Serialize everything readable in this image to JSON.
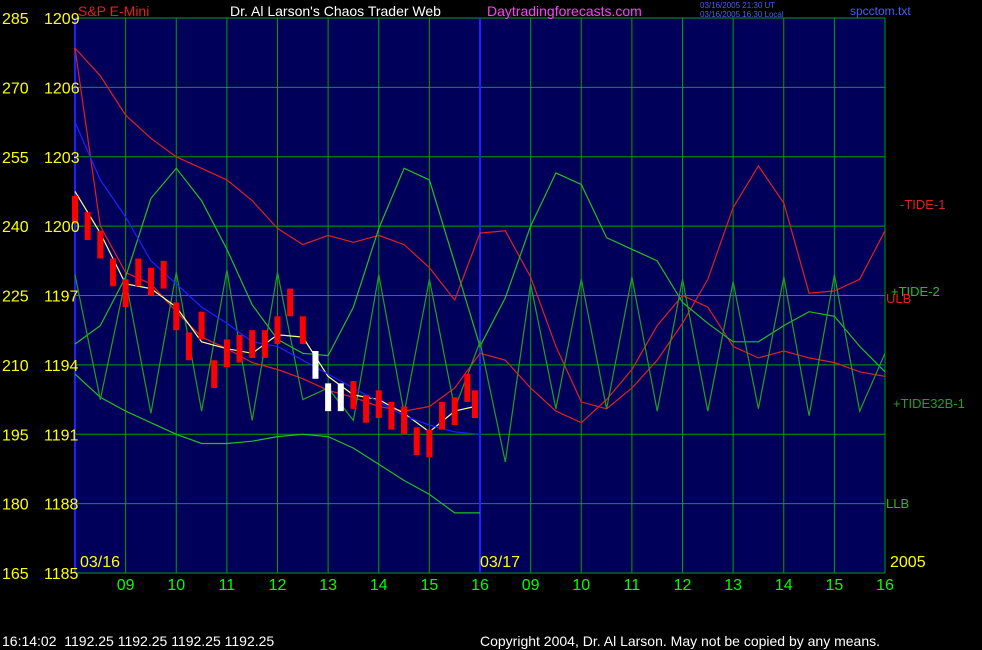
{
  "header": {
    "instrument": "S&P E-Mini",
    "title": "Dr. Al Larson's Chaos Trader Web",
    "site": "Daytradingforecasts.com",
    "timestamp_ut": "03/16/2005 21:30 UT",
    "timestamp_local": "03/16/2005 16:30 Local",
    "filename": "spcctom.txt"
  },
  "footer": {
    "readout": "16:14:02  1192.25 1192.25 1192.25 1192.25",
    "copyright": "Copyright 2004, Dr. Al Larson. May not be copied by any means."
  },
  "colors": {
    "background": "#000000",
    "plot_bg": "#00005a",
    "grid": "#00a000",
    "price_bars": "#ff0000",
    "price_bars_highlight": "#ffffff",
    "moving_avg": "#ffff80",
    "blue_curve": "#2020ff",
    "axis_text": "#ffff00",
    "hour_labels": "#00ff00",
    "tide1": "#e02020",
    "tide2": "#20c020",
    "tide32b1": "#20a020",
    "title_text": "#ffffff",
    "site_text": "#ff40ff"
  },
  "chart_data": {
    "type": "line",
    "y_axis_left_outer": [
      "285",
      "270",
      "255",
      "240",
      "225",
      "210",
      "195",
      "180",
      "165"
    ],
    "y_axis_left_inner": [
      "1209",
      "1206",
      "1203",
      "1200",
      "1197",
      "1194",
      "1191",
      "1188",
      "1185"
    ],
    "ylim": [
      1185,
      1209
    ],
    "x_hours_day1": [
      "09",
      "10",
      "11",
      "12",
      "13",
      "14",
      "15",
      "16"
    ],
    "x_hours_day2": [
      "09",
      "10",
      "11",
      "12",
      "13",
      "14",
      "15",
      "16"
    ],
    "date_labels": [
      "03/16",
      "03/17",
      "2005"
    ],
    "curve_labels": [
      "-TIDE-1",
      "+TIDE-2",
      "ULB",
      "+TIDE32B-1",
      "LLB"
    ],
    "series": [
      {
        "name": "-TIDE-1",
        "x": [
          0,
          0.5,
          1,
          1.5,
          2,
          2.5,
          3,
          3.5,
          4,
          4.5,
          5,
          5.5,
          6,
          6.5,
          7,
          7.5,
          8,
          8.5,
          9,
          9.5,
          10,
          10.5,
          11,
          11.5,
          12,
          12.5,
          13,
          13.5,
          14,
          14.5,
          15,
          15.5,
          16
        ],
        "values": [
          1207.7,
          1206.5,
          1204.8,
          1203.8,
          1203.0,
          1202.5,
          1202.0,
          1201.1,
          1199.9,
          1199.2,
          1199.6,
          1199.3,
          1199.6,
          1199.2,
          1198.2,
          1196.8,
          1199.7,
          1199.8,
          1197.8,
          1194.8,
          1192.4,
          1192.1,
          1193.0,
          1194.2,
          1195.8,
          1197.7,
          1200.8,
          1202.6,
          1201.0,
          1197.1,
          1197.2,
          1197.7,
          1199.8
        ]
      },
      {
        "name": "ULB",
        "x": [
          0,
          0.5,
          1,
          1.5,
          2,
          2.5,
          3,
          3.5,
          4,
          4.5,
          5,
          5.5,
          6,
          6.5,
          7,
          7.5,
          8,
          8.5,
          9,
          9.5,
          10,
          10.5,
          11,
          11.5,
          12,
          12.5,
          13,
          13.5,
          14,
          14.5,
          15,
          15.5,
          16
        ],
        "values": [
          1207.7,
          1200.0,
          1198.0,
          1197.5,
          1196.3,
          1195.2,
          1194.7,
          1194.1,
          1193.8,
          1193.4,
          1192.9,
          1192.6,
          1192.2,
          1192.0,
          1192.2,
          1193.0,
          1194.5,
          1194.2,
          1193.0,
          1192.0,
          1191.5,
          1192.5,
          1193.8,
          1195.7,
          1197.0,
          1196.5,
          1194.8,
          1194.3,
          1194.6,
          1194.3,
          1194.1,
          1193.7,
          1193.5
        ]
      },
      {
        "name": "+TIDE-2",
        "x": [
          0,
          0.5,
          1,
          1.5,
          2,
          2.5,
          3,
          3.5,
          4,
          4.5,
          5,
          5.5,
          6,
          6.5,
          7,
          7.5,
          8,
          8.5,
          9,
          9.5,
          10,
          10.5,
          11,
          11.5,
          12,
          12.5,
          13,
          13.5,
          14,
          14.5,
          15,
          15.5,
          16
        ],
        "values": [
          1194.9,
          1195.7,
          1197.8,
          1201.2,
          1202.5,
          1201.1,
          1199.0,
          1196.6,
          1195.1,
          1194.5,
          1194.4,
          1196.5,
          1199.9,
          1202.5,
          1202.0,
          1198.4,
          1194.8,
          1196.9,
          1200.0,
          1202.3,
          1201.8,
          1199.5,
          1199.0,
          1198.5,
          1196.7,
          1195.8,
          1195.0,
          1195.0,
          1195.7,
          1196.3,
          1196.1,
          1194.8,
          1193.7
        ]
      },
      {
        "name": "LLB",
        "x": [
          0,
          0.5,
          1,
          1.5,
          2,
          2.5,
          3,
          3.5,
          4,
          4.5,
          5,
          5.5,
          6,
          6.5,
          7,
          7.5,
          8
        ],
        "values": [
          1193.6,
          1192.6,
          1192.0,
          1191.5,
          1191.0,
          1190.6,
          1190.6,
          1190.7,
          1190.9,
          1191.0,
          1190.9,
          1190.4,
          1189.7,
          1189.0,
          1188.4,
          1187.6,
          1187.6
        ]
      },
      {
        "name": "+TIDE32B-1",
        "x": [
          0,
          0.5,
          1,
          1.5,
          2,
          2.5,
          3,
          3.5,
          4,
          4.5,
          5,
          5.5,
          6,
          6.5,
          7,
          7.5,
          8,
          8.5,
          9,
          9.5,
          10,
          10.5,
          11,
          11.5,
          12,
          12.5,
          13,
          13.5,
          14,
          14.5,
          15,
          15.5,
          16
        ],
        "values": [
          1197.9,
          1192.5,
          1197.7,
          1191.9,
          1198.0,
          1192.0,
          1198.1,
          1191.6,
          1198.0,
          1192.5,
          1193.0,
          1191.6,
          1197.9,
          1191.9,
          1197.7,
          1192.1,
          1195.0,
          1189.8,
          1197.5,
          1192.1,
          1197.7,
          1192.1,
          1197.8,
          1192.0,
          1197.7,
          1192.0,
          1197.6,
          1192.1,
          1197.8,
          1191.8,
          1197.9,
          1192.0,
          1194.5
        ]
      },
      {
        "name": "price",
        "x": [
          0,
          0.25,
          0.5,
          0.75,
          1,
          1.25,
          1.5,
          1.75,
          2,
          2.25,
          2.5,
          2.75,
          3,
          3.25,
          3.5,
          3.75,
          4,
          4.25,
          4.5,
          4.75,
          5,
          5.25,
          5.5,
          5.75,
          6,
          6.25,
          6.5,
          6.75,
          7,
          7.25,
          7.5,
          7.75,
          7.9
        ],
        "values": [
          1200.7,
          1200.0,
          1199.2,
          1198.0,
          1197.1,
          1198.0,
          1197.6,
          1197.9,
          1196.1,
          1194.8,
          1195.7,
          1193.6,
          1194.5,
          1194.7,
          1194.9,
          1194.9,
          1195.5,
          1196.7,
          1195.5,
          1194.0,
          1192.6,
          1192.6,
          1192.7,
          1192.1,
          1192.3,
          1191.8,
          1191.6,
          1190.7,
          1190.6,
          1191.8,
          1192.0,
          1193.0,
          1192.3
        ]
      },
      {
        "name": "moving-avg",
        "x": [
          0,
          0.5,
          1,
          1.5,
          2,
          2.5,
          3,
          3.5,
          4,
          4.5,
          5,
          5.5,
          6,
          6.5,
          7,
          7.5,
          7.9
        ],
        "values": [
          1201.5,
          1199.7,
          1197.5,
          1197.3,
          1196.5,
          1195.0,
          1194.7,
          1194.5,
          1195.3,
          1195.2,
          1193.5,
          1192.7,
          1192.5,
          1191.9,
          1191.1,
          1192.0,
          1192.2
        ]
      },
      {
        "name": "blue",
        "x": [
          0,
          0.5,
          1,
          1.5,
          2,
          2.5,
          3,
          3.5,
          4,
          4.5,
          5,
          5.5,
          6,
          6.5,
          7,
          7.5,
          8
        ],
        "values": [
          1204.5,
          1202.0,
          1200.4,
          1198.5,
          1197.5,
          1196.5,
          1195.8,
          1195.0,
          1194.8,
          1194.2,
          1193.6,
          1193.0,
          1192.4,
          1191.8,
          1191.4,
          1191.1,
          1191.0
        ]
      }
    ]
  }
}
